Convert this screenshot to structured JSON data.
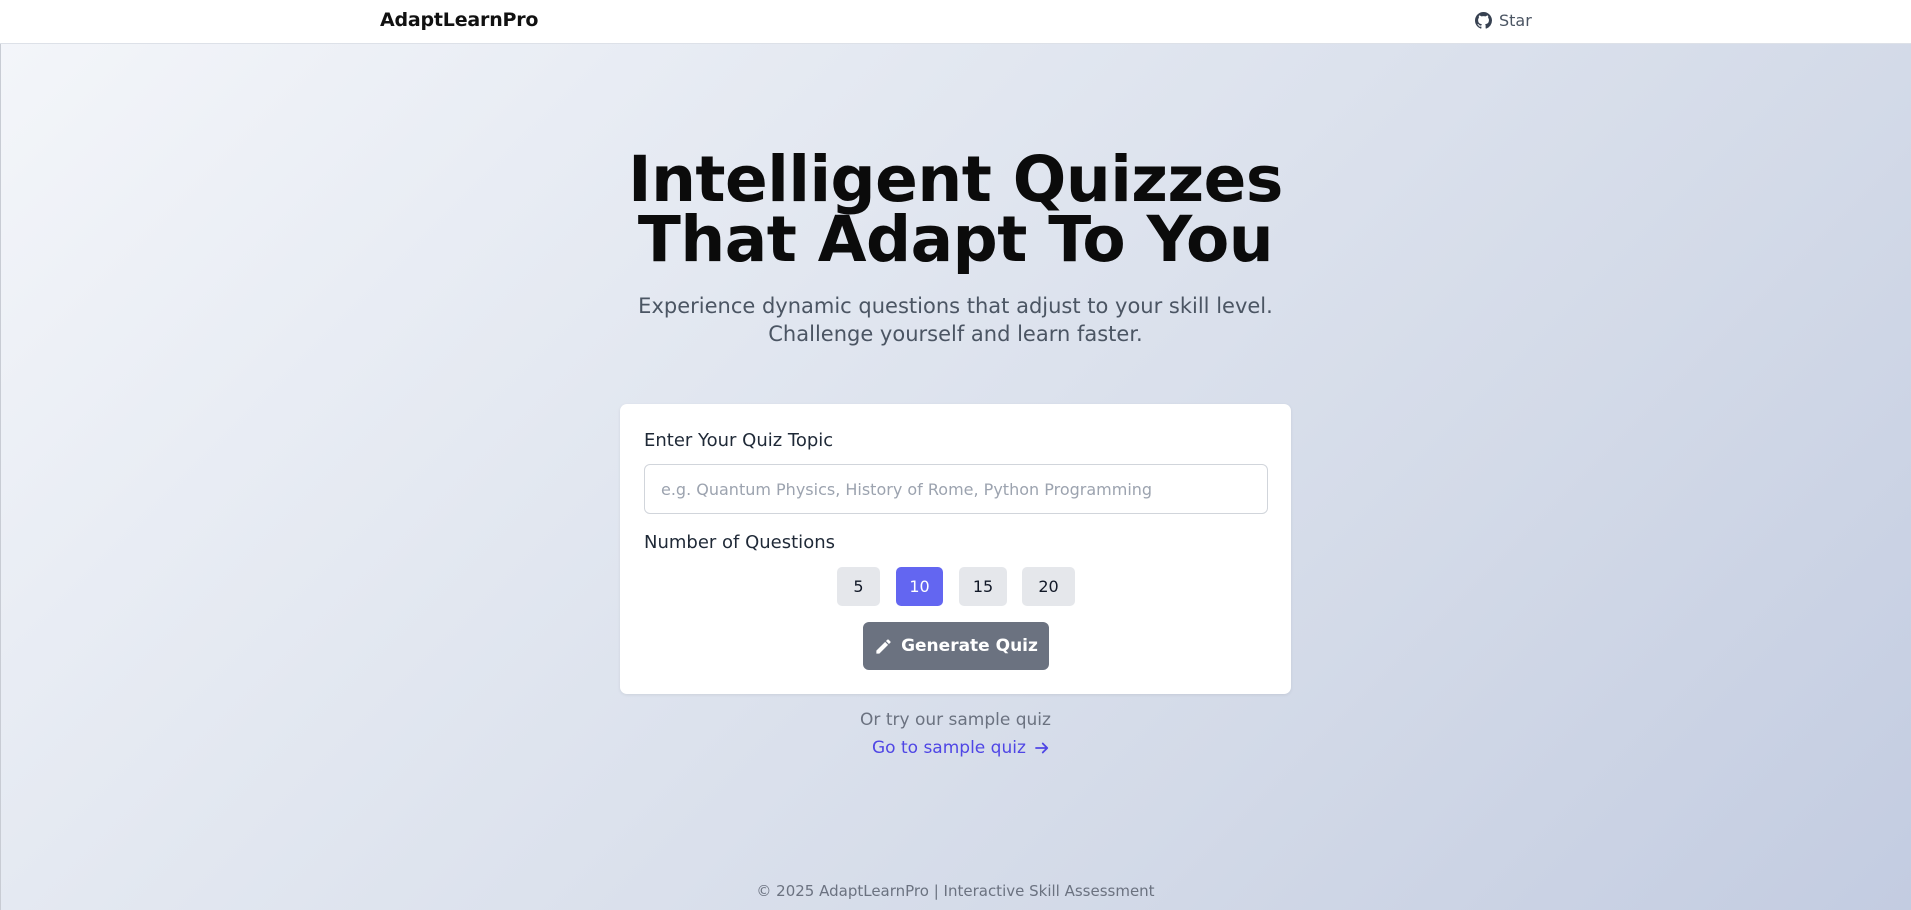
{
  "header": {
    "brand": "AdaptLearnPro",
    "star_label": "Star",
    "star_icon": "github-icon"
  },
  "hero": {
    "title_line1": "Intelligent Quizzes",
    "title_line2": "That Adapt To You",
    "subtitle_line1": "Experience dynamic questions that adjust to your skill level.",
    "subtitle_line2": "Challenge yourself and learn faster."
  },
  "form": {
    "topic_label": "Enter Your Quiz Topic",
    "topic_value": "",
    "topic_placeholder": "e.g. Quantum Physics, History of Rome, Python Programming",
    "count_label": "Number of Questions",
    "count_options": [
      "5",
      "10",
      "15",
      "20"
    ],
    "selected_count": "10",
    "generate_label": "Generate Quiz",
    "generate_icon": "pencil-icon"
  },
  "sample": {
    "prompt": "Or try our sample quiz",
    "link_label": "Go to sample quiz",
    "link_icon": "arrow-right-icon"
  },
  "footer": {
    "text": "© 2025 AdaptLearnPro | Interactive Skill Assessment"
  },
  "colors": {
    "accent": "#6366f1",
    "link": "#4f46e5",
    "generate_button": "#6b7280",
    "option_button": "#e5e7eb"
  }
}
